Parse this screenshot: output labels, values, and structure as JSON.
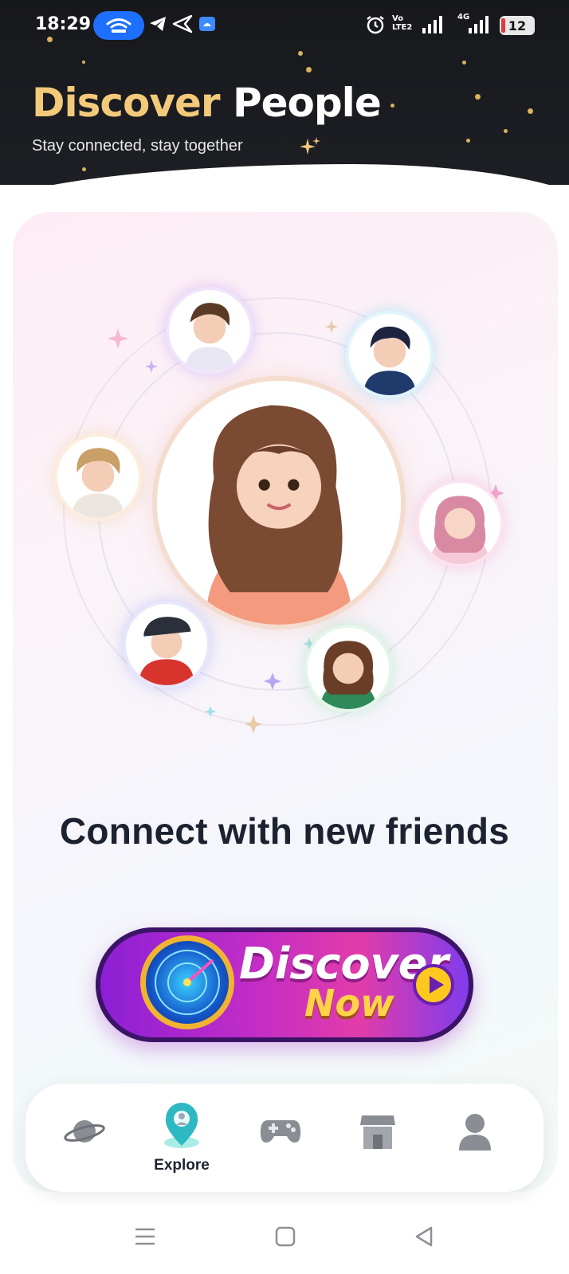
{
  "status_bar": {
    "time": "18:29",
    "network_label_top": "Vo",
    "network_label_bottom": "LTE2",
    "network_type": "4G",
    "battery": "12",
    "icons": [
      "hotspot-icon",
      "telegram-icon",
      "send-icon",
      "android-icon",
      "alarm-icon",
      "signal-icon",
      "signal-icon",
      "battery-icon"
    ]
  },
  "header": {
    "title_part1": "Discover",
    "title_part2": "People",
    "subtitle": "Stay connected, stay together",
    "colors": {
      "title_accent": "#f3c97a",
      "background": "#17181c"
    }
  },
  "main": {
    "headline": "Connect with new friends",
    "discover_button": {
      "line1": "Discover",
      "line2": "Now"
    },
    "avatars": [
      "center-avatar",
      "avatar-top-left",
      "avatar-top-right",
      "avatar-left",
      "avatar-right",
      "avatar-bottom-left",
      "avatar-bottom-right"
    ]
  },
  "bottom_nav": {
    "items": [
      {
        "id": "planet",
        "icon": "planet-icon",
        "label": ""
      },
      {
        "id": "explore",
        "icon": "location-pin-icon",
        "label": "Explore",
        "active": true
      },
      {
        "id": "games",
        "icon": "gamepad-icon",
        "label": ""
      },
      {
        "id": "store",
        "icon": "store-icon",
        "label": ""
      },
      {
        "id": "profile",
        "icon": "user-icon",
        "label": ""
      }
    ]
  },
  "system_nav": {
    "icons": [
      "menu-icon",
      "home-icon",
      "back-icon"
    ]
  }
}
